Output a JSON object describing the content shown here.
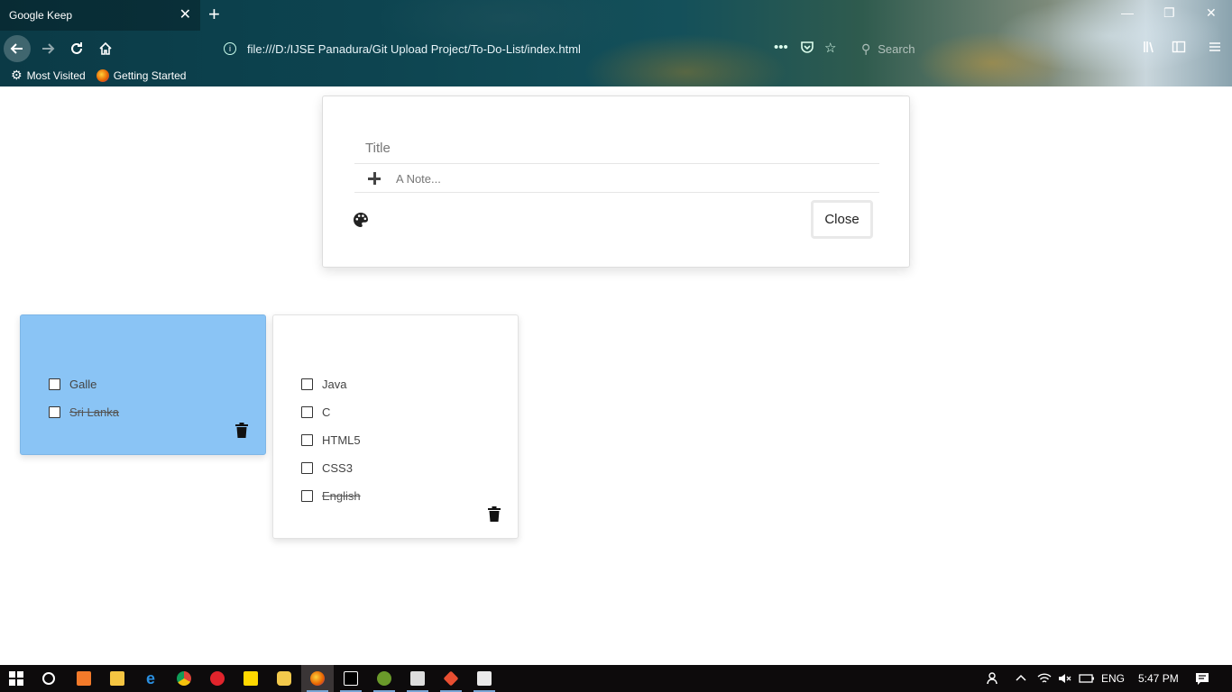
{
  "browser": {
    "tab_title": "Google Keep",
    "tab_close": "✕",
    "new_tab": "+",
    "url": "file:///D:/IJSE Panadura/Git Upload Project/To-Do-List/index.html",
    "search_placeholder": "Search",
    "bookmarks": [
      {
        "label": "Most Visited",
        "icon": "gear-icon"
      },
      {
        "label": "Getting Started",
        "icon": "firefox-icon"
      }
    ],
    "window_controls": {
      "minimize": "—",
      "restore": "❐",
      "close": "✕"
    }
  },
  "editor": {
    "title_placeholder": "Title",
    "note_placeholder": "A Note...",
    "close_label": "Close"
  },
  "cards": [
    {
      "color": "#8ac4f5",
      "items": [
        {
          "text": "Galle",
          "done": false
        },
        {
          "text": "Sri Lanka",
          "done": true
        }
      ]
    },
    {
      "color": "#ffffff",
      "items": [
        {
          "text": "Java",
          "done": false
        },
        {
          "text": "C",
          "done": false
        },
        {
          "text": "HTML5",
          "done": false
        },
        {
          "text": "CSS3",
          "done": false
        },
        {
          "text": "English",
          "done": true
        }
      ]
    }
  ],
  "taskbar": {
    "language": "ENG",
    "time": "5:47 PM"
  }
}
